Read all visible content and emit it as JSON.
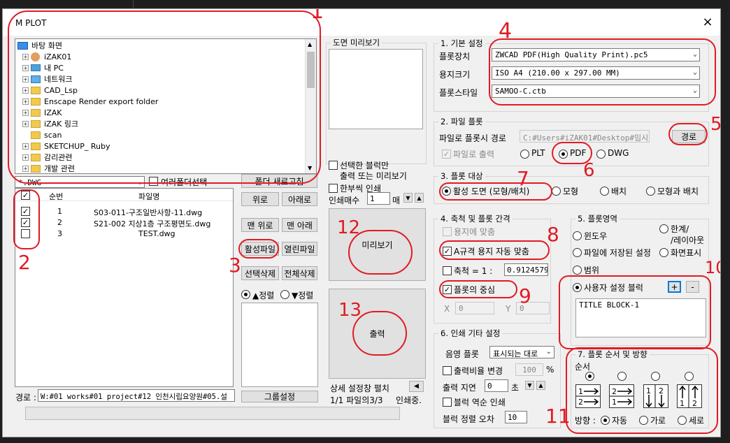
{
  "window": {
    "title": "M PLOT",
    "close": "×"
  },
  "tree": {
    "root": "바탕 화면",
    "items": [
      "iZAK01",
      "내 PC",
      "네트워크",
      "CAD_Lsp",
      "Enscape Render export folder",
      "IZAK",
      "iZAK 링크",
      "scan",
      "SKETCHUP_ Ruby",
      "감리관련",
      "개발 관련"
    ]
  },
  "filter": {
    "value": "*.DWG",
    "multi_folder": "여러폴더선택"
  },
  "file_list": {
    "columns": [
      "순번",
      "파일명"
    ],
    "rows": [
      {
        "no": "1",
        "name": "S03-011-구조일반사항-11.dwg",
        "checked": true
      },
      {
        "no": "2",
        "name": "S21-002 지상1층 구조평면도.dwg",
        "checked": true
      },
      {
        "no": "3",
        "name": "TEST.dwg",
        "checked": false
      }
    ]
  },
  "path": {
    "label": "경로 :",
    "value": "W:#01 works#01 project#12 인천시립요양원#05.설"
  },
  "mid_buttons": {
    "refresh": "폴더 새로고침",
    "up": "위로",
    "down": "아래로",
    "top": "맨 위로",
    "bottom": "맨 아래",
    "active_file": "활성파일",
    "open_file": "열린파일",
    "delete_sel": "선택삭제",
    "delete_all": "전체삭제",
    "sort_asc": "▲정렬",
    "sort_desc": "▼정렬",
    "group_settings": "그룹설정"
  },
  "preview": {
    "title": "도면 미리보기",
    "selected_block": "선택한 블럭만",
    "selected_block2": "출력 또는 미리보기",
    "one_by_one": "한부씩 인쇄",
    "copies_label": "인쇄매수",
    "copies_value": "1",
    "copies_unit": "매",
    "preview_button": "미리보기",
    "output_button": "출력",
    "detail_label": "상세 설정창 펼치",
    "status": "1/1 파일의3/3",
    "status2": "인쇄중."
  },
  "basic": {
    "title": "1. 기본 설정",
    "plotter_label": "플롯장치",
    "plotter": "ZWCAD PDF(High Quality Print).pc5",
    "paper_label": "용지크기",
    "paper": "ISO A4 (210.00 x 297.00 MM)",
    "style_label": "플롯스타일",
    "style": "SAMOO-C.ctb"
  },
  "file_plot": {
    "title": "2. 파일 플롯",
    "path_label": "파일로 플롯시 경로",
    "path": "C:#Users#iZAK01#Desktop#임시",
    "browse": "경로",
    "to_file": "파일로 출력",
    "fmt_plt": "PLT",
    "fmt_pdf": "PDF",
    "fmt_dwg": "DWG"
  },
  "target": {
    "title": "3. 플롯 대상",
    "active": "활성 도면 (모형/배치)",
    "model": "모형",
    "layout": "배치",
    "both": "모형과 배치"
  },
  "scale": {
    "title": "4. 축척 및 플롯 간격",
    "fit": "용지에 맞춤",
    "a_size": "A규격 용지 자동 맞춤",
    "scale_label": "축척 = 1 :",
    "scale_value": "0.9124579",
    "center": "플롯의 중심",
    "x_label": "X",
    "x_value": "0",
    "y_label": "Y",
    "y_value": "0"
  },
  "area": {
    "title": "5. 플롯영역",
    "window": "윈도우",
    "limits1": "한계/",
    "limits2": "/레이아웃",
    "saved": "파일에 저장된 설정",
    "display": "화면표시",
    "extents": "범위",
    "user_block": "사용자 설정 블럭",
    "add": "+",
    "remove": "-",
    "block_item": "TITLE BLOCK-1"
  },
  "etc": {
    "title": "6. 인쇄 기타 설정",
    "shade_label": "음영 플롯",
    "shade_value": "표시되는 대로",
    "ratio_label": "출력비율 변경",
    "ratio_value": "100",
    "ratio_unit": "%",
    "delay_label": "출력 지연",
    "delay_value": "0",
    "delay_unit": "초",
    "reverse": "블럭 역순 인쇄",
    "tolerance_label": "블럭 정렬 오차",
    "tolerance_value": "10"
  },
  "order": {
    "title": "7. 플롯 순서 및 방향",
    "order_label": "순서",
    "dir_label": "방향 :",
    "auto": "자동",
    "horiz": "가로",
    "vert": "세로"
  },
  "annotations": [
    "1",
    "2",
    "3",
    "4",
    "5",
    "6",
    "7",
    "8",
    "9",
    "10",
    "11",
    "12",
    "13"
  ],
  "colors": {
    "annotation": "#e01b24",
    "accent": "#0078d7"
  }
}
